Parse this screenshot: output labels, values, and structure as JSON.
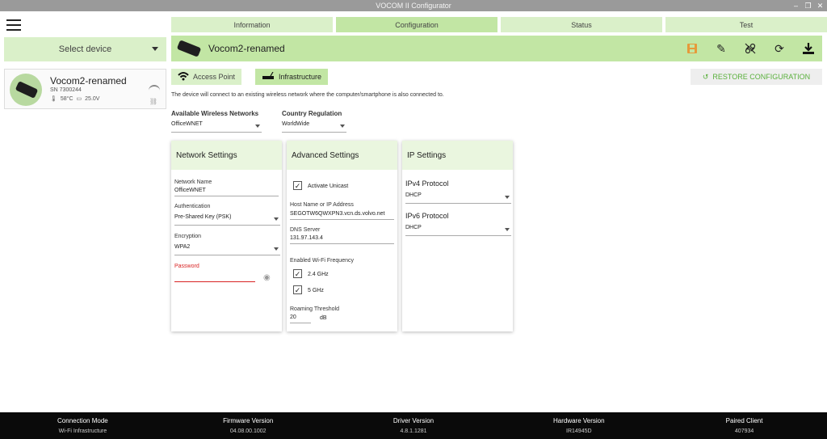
{
  "window": {
    "title": "VOCOM II Configurator",
    "controls": [
      "–",
      "❐",
      "✕"
    ]
  },
  "sidebar": {
    "select_device_label": "Select device",
    "device": {
      "name": "Vocom2-renamed",
      "serial": "SN 7300244",
      "temperature": "58°C",
      "voltage": "25.0V"
    }
  },
  "tabs": [
    {
      "label": "Information"
    },
    {
      "label": "Configuration",
      "active": true
    },
    {
      "label": "Status"
    },
    {
      "label": "Test"
    }
  ],
  "header": {
    "device_name": "Vocom2-renamed",
    "icons": [
      "save-icon",
      "edit-icon",
      "unlink-icon",
      "refresh-icon",
      "download-icon"
    ]
  },
  "mode": {
    "access_point_label": "Access Point",
    "infrastructure_label": "Infrastructure",
    "restore_label": "RESTORE CONFIGURATION",
    "description": "The device will connect to an existing wireless network where the computer/smartphone is also connected to."
  },
  "networks": {
    "available_label": "Available Wireless Networks",
    "available_value": "OfficeWNET",
    "country_label": "Country Regulation",
    "country_value": "WorldWide"
  },
  "network_settings": {
    "title": "Network Settings",
    "name_label": "Network Name",
    "name_value": "OfficeWNET",
    "auth_label": "Authentication",
    "auth_value": "Pre-Shared Key (PSK)",
    "enc_label": "Encryption",
    "enc_value": "WPA2",
    "password_label": "Password",
    "password_value": ""
  },
  "advanced_settings": {
    "title": "Advanced Settings",
    "unicast_label": "Activate Unicast",
    "unicast_checked": true,
    "host_label": "Host Name or IP Address",
    "host_value": "SEGOTW6QWXPN3.vcn.ds.volvo.net",
    "dns_label": "DNS Server",
    "dns_value": "131.97.143.4",
    "freq_label": "Enabled Wi-Fi Frequency",
    "freq_24_label": "2.4 GHz",
    "freq_24_checked": true,
    "freq_5_label": "5 GHz",
    "freq_5_checked": true,
    "roaming_label": "Roaming Threshold",
    "roaming_value": "20",
    "roaming_unit": "dB"
  },
  "ip_settings": {
    "title": "IP Settings",
    "ipv4_label": "IPv4 Protocol",
    "ipv4_value": "DHCP",
    "ipv6_label": "IPv6 Protocol",
    "ipv6_value": "DHCP"
  },
  "footer": [
    {
      "label": "Connection Mode",
      "value": "Wi-Fi Infrastructure"
    },
    {
      "label": "Firmware Version",
      "value": "04.08.00.1002"
    },
    {
      "label": "Driver Version",
      "value": "4.8.1.1281"
    },
    {
      "label": "Hardware Version",
      "value": "IR14945D"
    },
    {
      "label": "Paired Client",
      "value": "407934"
    }
  ],
  "colors": {
    "accent_light": "#daf0c9",
    "accent": "#c2e6a4",
    "restore_text": "#5ab03c",
    "error": "#d82323",
    "save_icon": "#e69a3a"
  }
}
